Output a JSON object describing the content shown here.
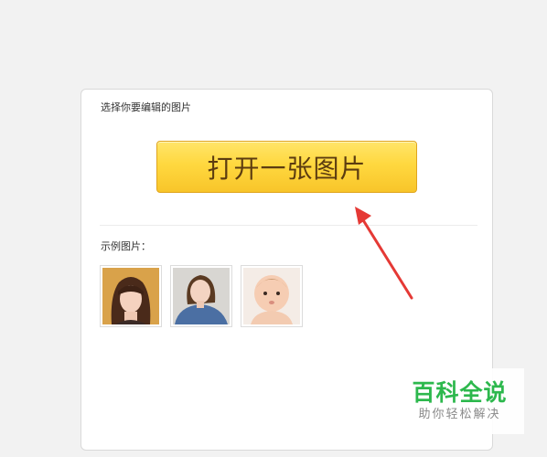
{
  "panel": {
    "title": "选择你要编辑的图片",
    "open_button_label": "打开一张图片",
    "examples_label": "示例图片："
  },
  "examples": [
    {
      "name": "portrait-woman-bangs"
    },
    {
      "name": "portrait-woman-denim"
    },
    {
      "name": "portrait-baby"
    }
  ],
  "annotation": {
    "arrow_color": "#e53935"
  },
  "watermark": {
    "title": "百科全说",
    "subtitle": "助你轻松解决",
    "title_color": "#2db84d"
  }
}
